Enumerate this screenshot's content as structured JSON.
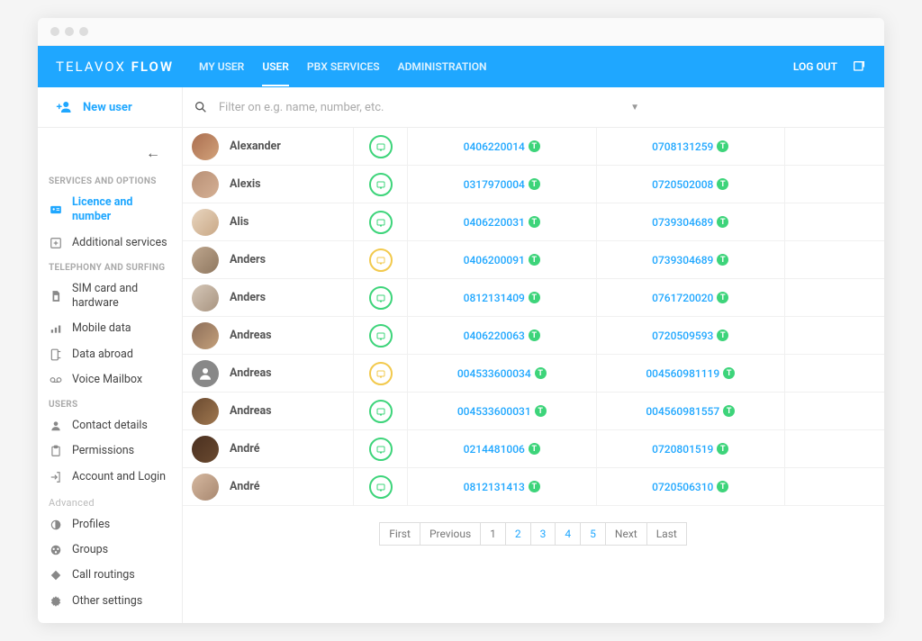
{
  "brand": {
    "part1": "TELAVOX",
    "part2": "FLOW"
  },
  "nav": {
    "my_user": "MY USER",
    "user": "USER",
    "pbx": "PBX SERVICES",
    "admin": "ADMINISTRATION"
  },
  "logout": "LOG OUT",
  "new_user": "New user",
  "search": {
    "placeholder": "Filter on e.g. name, number, etc."
  },
  "sidebar": {
    "services_header": "SERVICES AND OPTIONS",
    "licence": "Licence and number",
    "additional": "Additional services",
    "telephony_header": "TELEPHONY AND SURFING",
    "sim": "SIM card and hardware",
    "mobile_data": "Mobile data",
    "data_abroad": "Data abroad",
    "voice_mailbox": "Voice Mailbox",
    "users_header": "USERS",
    "contact_details": "Contact details",
    "permissions": "Permissions",
    "account_login": "Account and Login",
    "advanced_header": "Advanced",
    "profiles": "Profiles",
    "groups": "Groups",
    "call_routings": "Call routings",
    "other_settings": "Other settings"
  },
  "users": [
    {
      "name": "Alexander",
      "status": "green",
      "num1": "0406220014",
      "num2": "0708131259",
      "avatar": "a1"
    },
    {
      "name": "Alexis",
      "status": "green",
      "num1": "0317970004",
      "num2": "0720502008",
      "avatar": "a2"
    },
    {
      "name": "Alis",
      "status": "green",
      "num1": "0406220031",
      "num2": "0739304689",
      "avatar": "a3"
    },
    {
      "name": "Anders",
      "status": "yellow",
      "num1": "0406200091",
      "num2": "0739304689",
      "avatar": "a4"
    },
    {
      "name": "Anders",
      "status": "green",
      "num1": "0812131409",
      "num2": "0761720020",
      "avatar": "a5"
    },
    {
      "name": "Andreas",
      "status": "green",
      "num1": "0406220063",
      "num2": "0720509593",
      "avatar": "a6"
    },
    {
      "name": "Andreas",
      "status": "yellow",
      "num1": "004533600034",
      "num2": "004560981119",
      "avatar": "blank"
    },
    {
      "name": "Andreas",
      "status": "green",
      "num1": "004533600031",
      "num2": "004560981557",
      "avatar": "a7"
    },
    {
      "name": "André",
      "status": "green",
      "num1": "0214481006",
      "num2": "0720801519",
      "avatar": "a8"
    },
    {
      "name": "André",
      "status": "green",
      "num1": "0812131413",
      "num2": "0720506310",
      "avatar": "a9"
    }
  ],
  "avatar_colors": {
    "a1": "linear-gradient(135deg,#aa6e50,#d2a27a)",
    "a2": "linear-gradient(135deg,#b89076,#d5b094)",
    "a3": "linear-gradient(135deg,#e8d5bf,#c9a886)",
    "a4": "linear-gradient(135deg,#bea68e,#8f7860)",
    "a5": "linear-gradient(135deg,#d5c7b8,#a89480)",
    "a6": "linear-gradient(135deg,#8c6e5a,#c4a07a)",
    "a7": "linear-gradient(135deg,#6a4a30,#a07850)",
    "a8": "linear-gradient(135deg,#4a3020,#6a4a30)",
    "a9": "linear-gradient(135deg,#d5b8a0,#a88870)"
  },
  "pagination": {
    "first": "First",
    "previous": "Previous",
    "p1": "1",
    "p2": "2",
    "p3": "3",
    "p4": "4",
    "p5": "5",
    "next": "Next",
    "last": "Last"
  },
  "t_badge": "T"
}
